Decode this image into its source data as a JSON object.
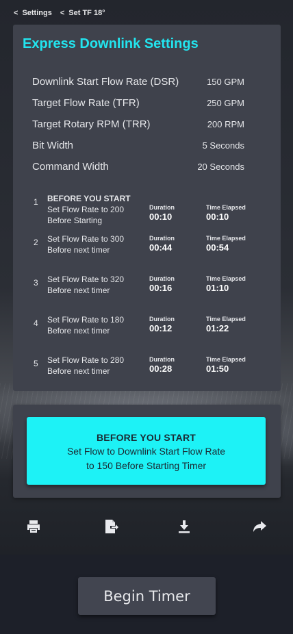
{
  "breadcrumb": [
    {
      "label": "Settings"
    },
    {
      "label": "Set TF 18°"
    }
  ],
  "panel": {
    "title": "Express Downlink Settings",
    "settings": [
      {
        "label": "Downlink Start Flow Rate (DSR)",
        "value": "150 GPM"
      },
      {
        "label": "Target Flow Rate (TFR)",
        "value": "250 GPM"
      },
      {
        "label": "Target Rotary RPM (TRR)",
        "value": "200 RPM"
      },
      {
        "label": "Bit Width",
        "value": "5 Seconds"
      },
      {
        "label": "Command Width",
        "value": "20 Seconds"
      }
    ],
    "duration_label": "Duration",
    "elapsed_label": "Time Elapsed",
    "steps": [
      {
        "num": "1",
        "heading": "BEFORE YOU START",
        "line1": "Set Flow Rate to 200",
        "line2": "Before Starting",
        "duration": "00:10",
        "elapsed": "00:10"
      },
      {
        "num": "2",
        "heading": "",
        "line1": "Set Flow Rate to 300",
        "line2": "Before next timer",
        "duration": "00:44",
        "elapsed": "00:54"
      },
      {
        "num": "3",
        "heading": "",
        "line1": "Set Flow Rate to 320",
        "line2": "Before next timer",
        "duration": "00:16",
        "elapsed": "01:10"
      },
      {
        "num": "4",
        "heading": "",
        "line1": "Set Flow Rate to 180",
        "line2": "Before next timer",
        "duration": "00:12",
        "elapsed": "01:22"
      },
      {
        "num": "5",
        "heading": "",
        "line1": "Set Flow Rate to 280",
        "line2": "Before next timer",
        "duration": "00:28",
        "elapsed": "01:50"
      }
    ]
  },
  "callout": {
    "heading": "BEFORE YOU START",
    "line1": "Set Flow to Downlink Start Flow Rate",
    "line2": "to 150 Before Starting Timer"
  },
  "toolbar": {
    "icons": [
      "print-icon",
      "export-icon",
      "download-icon",
      "share-icon"
    ]
  },
  "begin_button": {
    "label": "Begin Timer"
  },
  "colors": {
    "accent": "#22e5ef",
    "callout_bg": "#1df2f6",
    "panel_bg": "#3f424c"
  }
}
